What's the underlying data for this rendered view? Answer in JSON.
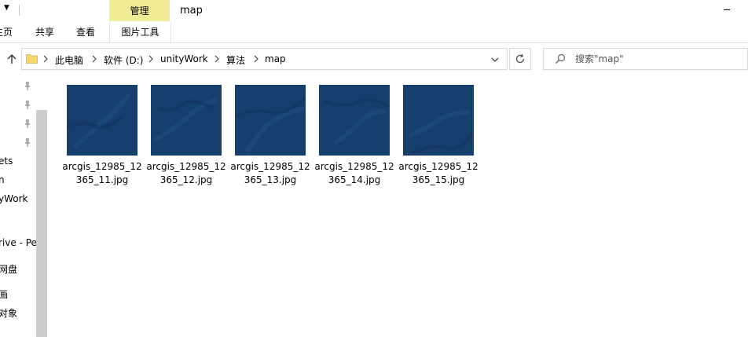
{
  "titlebar": {
    "window_title": "map",
    "tool_tab_header": "管理"
  },
  "ribbon": {
    "tabs": [
      {
        "label": "主页"
      },
      {
        "label": "共享"
      },
      {
        "label": "查看"
      },
      {
        "label": "图片工具"
      }
    ]
  },
  "address": {
    "breadcrumbs": [
      "此电脑",
      "软件 (D:)",
      "unityWork",
      "算法",
      "map"
    ]
  },
  "search": {
    "placeholder": "搜索\"map\""
  },
  "nav_pane": {
    "items": [
      "ets",
      "n",
      "yWork",
      "rive - Pe",
      "网盘",
      "画",
      "对象"
    ]
  },
  "files": [
    {
      "name": "arcgis_12985_12365_11.jpg"
    },
    {
      "name": "arcgis_12985_12365_12.jpg"
    },
    {
      "name": "arcgis_12985_12365_13.jpg"
    },
    {
      "name": "arcgis_12985_12365_14.jpg"
    },
    {
      "name": "arcgis_12985_12365_15.jpg"
    }
  ],
  "colors": {
    "tool_tab": "#f0ec95",
    "thumbnail_blue": "#173f6e",
    "folder_yellow": "#f6d56a"
  },
  "icons": [
    "up-arrow-icon",
    "folder-icon",
    "chevron-right-icon",
    "chevron-down-icon",
    "refresh-icon",
    "search-icon",
    "pin-icon"
  ]
}
